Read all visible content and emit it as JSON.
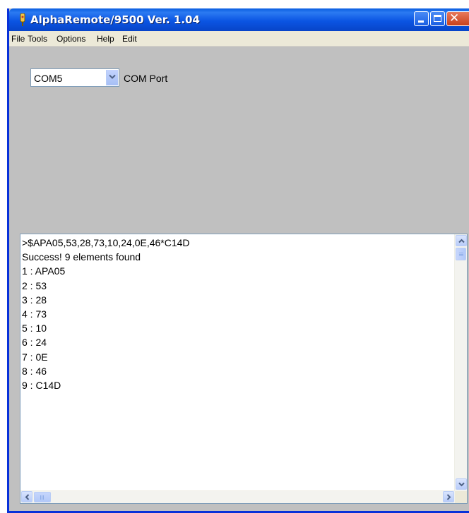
{
  "window": {
    "title": "AlphaRemote/9500 Ver. 1.04"
  },
  "menu": {
    "items": [
      "File",
      "Tools",
      "Options",
      "Help",
      "Edit"
    ]
  },
  "com_port": {
    "selected": "COM5",
    "label": "COM Port"
  },
  "output": {
    "lines": [
      ">$APA05,53,28,73,10,24,0E,46*C14D",
      "Success! 9 elements found",
      "1 : APA05",
      "2 : 53",
      "3 : 28",
      "4 : 73",
      "5 : 10",
      "6 : 24",
      "7 : 0E",
      "8 : 46",
      "9 : C14D"
    ]
  },
  "colors": {
    "titlebar": "#0b55e3",
    "client": "#c0c0c0",
    "menubar": "#ece9d8",
    "close_button": "#c9401c"
  },
  "icons": [
    "app-icon",
    "minimize-icon",
    "maximize-icon",
    "close-icon",
    "chevron-down-icon",
    "arrow-up-icon",
    "arrow-down-icon",
    "arrow-left-icon",
    "arrow-right-icon"
  ]
}
